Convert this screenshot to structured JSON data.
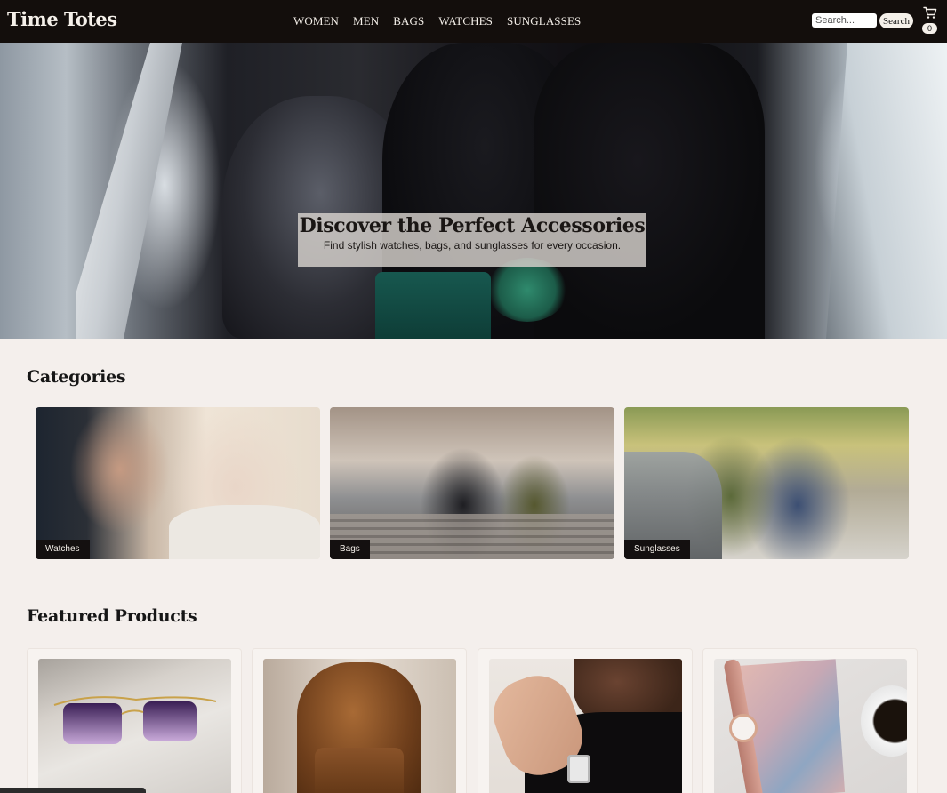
{
  "header": {
    "logo": "Time Totes",
    "nav": [
      "WOMEN",
      "MEN",
      "BAGS",
      "WATCHES",
      "SUNGLASSES"
    ],
    "search_placeholder": "Search...",
    "search_button": "Search",
    "cart_count": "0"
  },
  "hero": {
    "title": "Discover the Perfect Accessories",
    "subtitle": "Find stylish watches, bags, and sunglasses for every occasion."
  },
  "categories": {
    "title": "Categories",
    "items": [
      "Watches",
      "Bags",
      "Sunglasses"
    ]
  },
  "featured": {
    "title": "Featured Products"
  },
  "icons": {
    "cart": "cart-icon"
  }
}
